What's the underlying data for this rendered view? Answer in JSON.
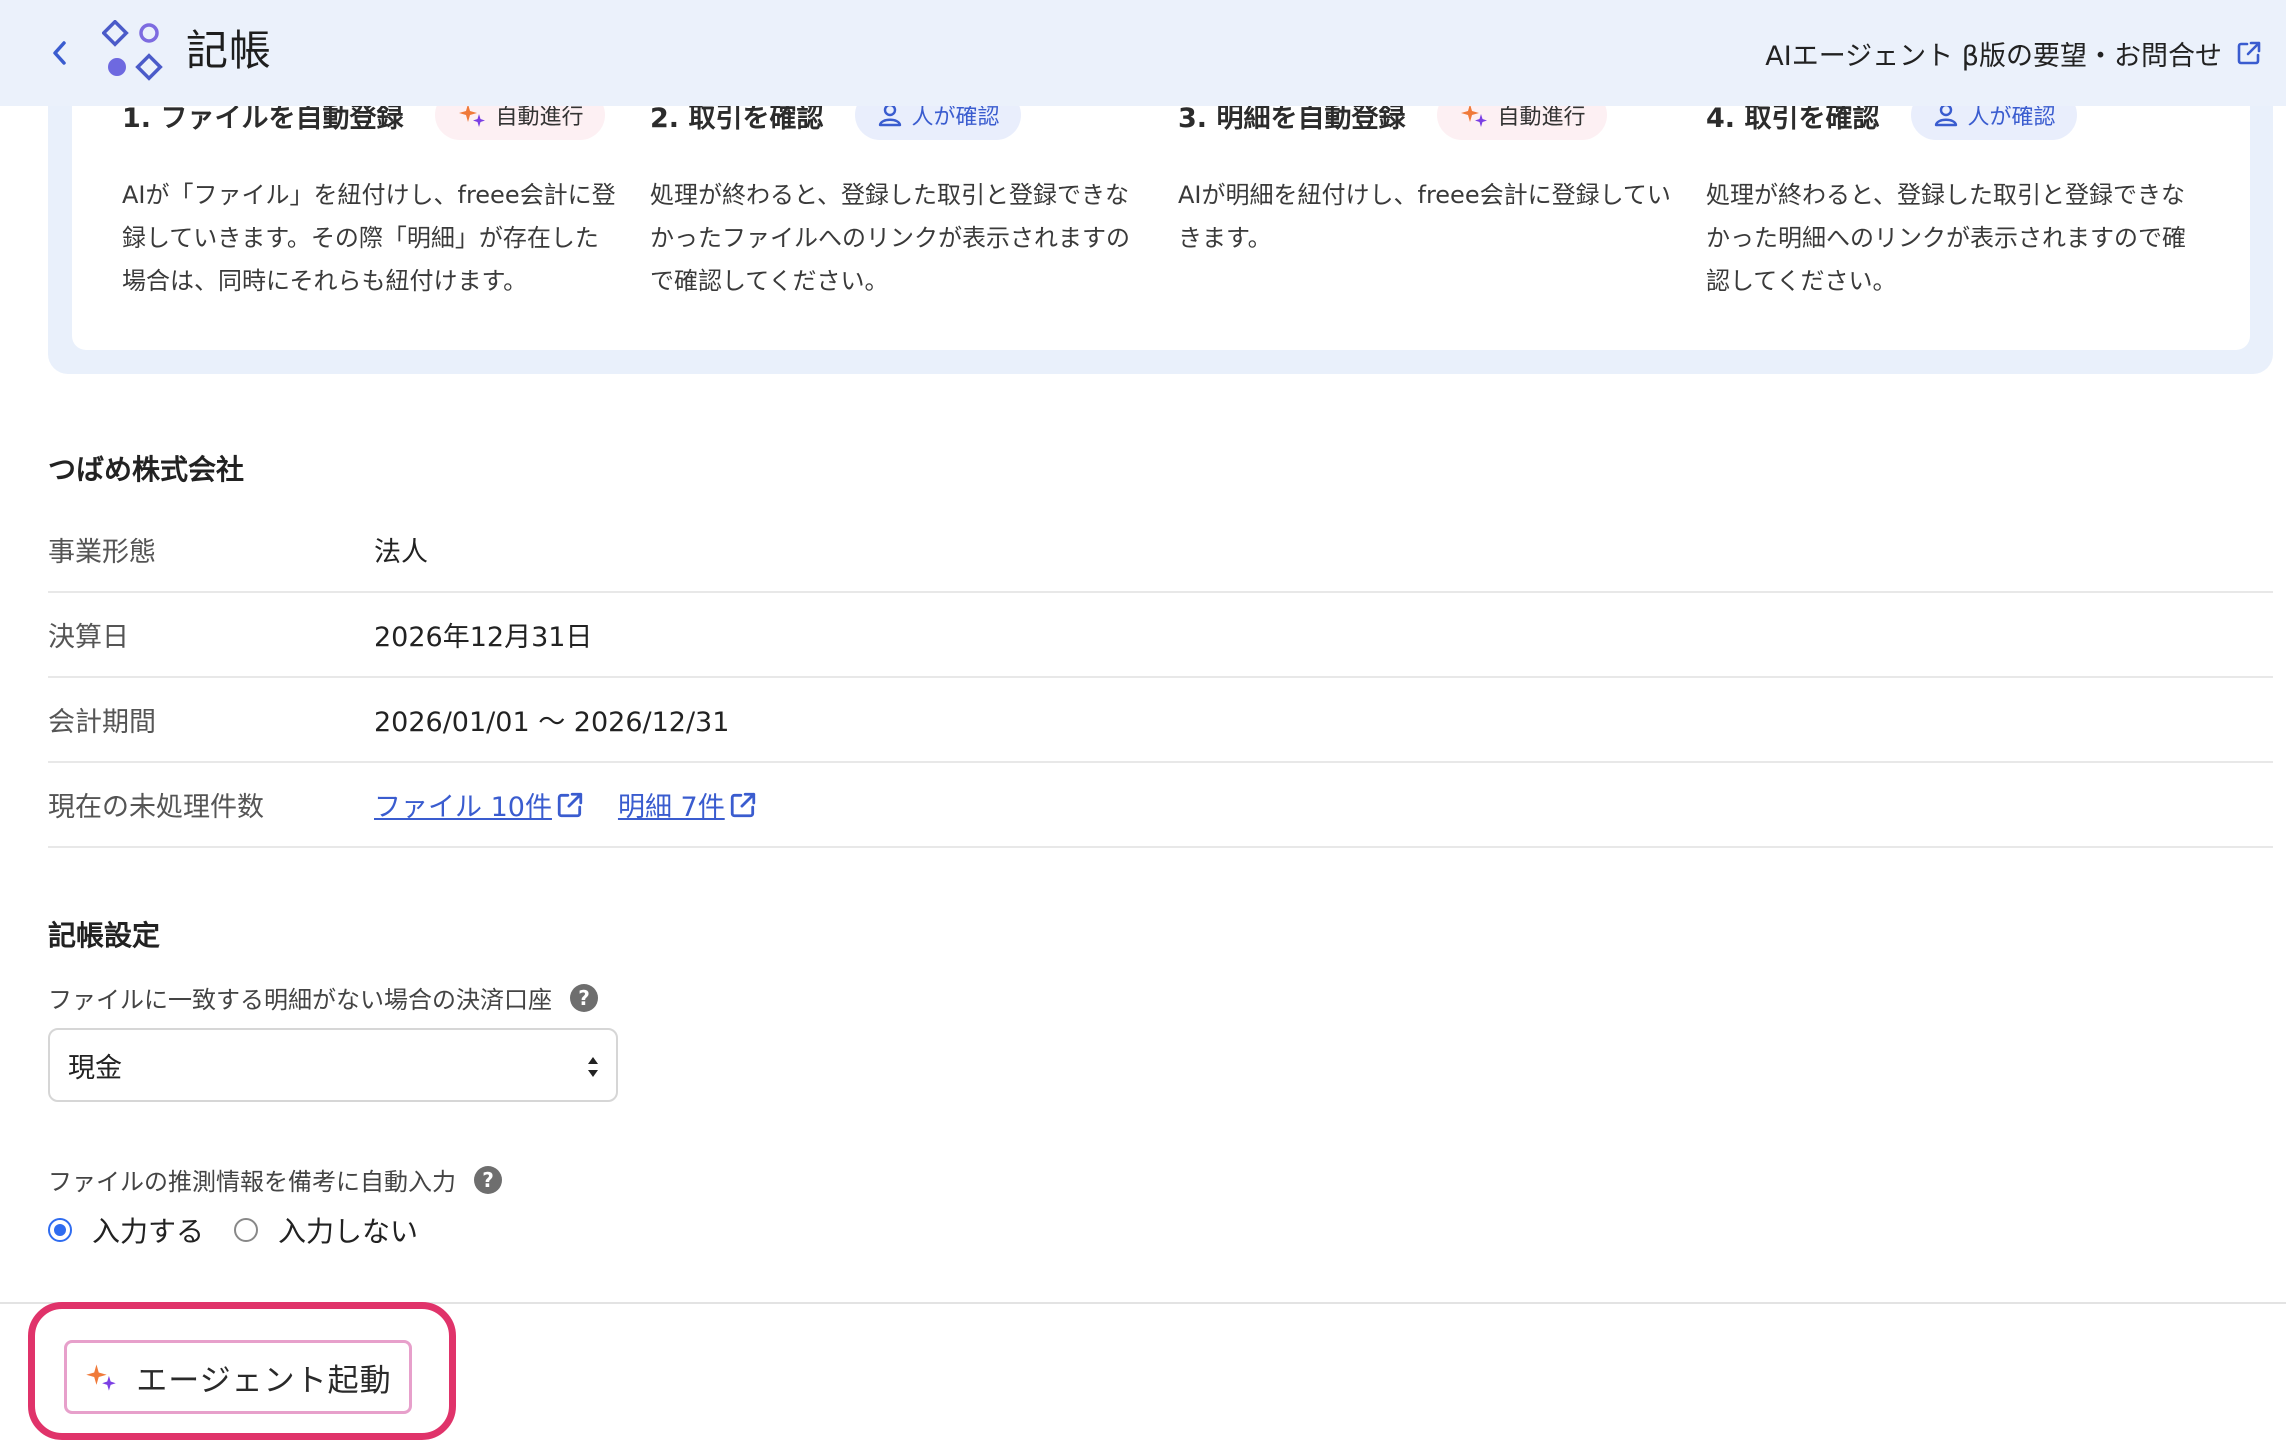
{
  "header": {
    "title": "記帳",
    "feedback_link": "AIエージェント β版の要望・お問合せ"
  },
  "steps": [
    {
      "title": "1. ファイルを自動登録",
      "badge": "自動進行",
      "badge_type": "auto",
      "desc": "AIが「ファイル」を紐付けし、freee会計に登録していきます。その際「明細」が存在した場合は、同時にそれらも紐付けます。"
    },
    {
      "title": "2. 取引を確認",
      "badge": "人が確認",
      "badge_type": "human",
      "desc": "処理が終わると、登録した取引と登録できなかったファイルへのリンクが表示されますので確認してください。"
    },
    {
      "title": "3. 明細を自動登録",
      "badge": "自動進行",
      "badge_type": "auto",
      "desc": "AIが明細を紐付けし、freee会計に登録していきます。"
    },
    {
      "title": "4. 取引を確認",
      "badge": "人が確認",
      "badge_type": "human",
      "desc": "処理が終わると、登録した取引と登録できなかった明細へのリンクが表示されますので確認してください。"
    }
  ],
  "company": {
    "name": "つばめ株式会社",
    "rows": {
      "business_type": {
        "label": "事業形態",
        "value": "法人"
      },
      "closing_date": {
        "label": "決算日",
        "value": "2026年12月31日"
      },
      "fiscal_period": {
        "label": "会計期間",
        "value": "2026/01/01 〜 2026/12/31"
      },
      "pending": {
        "label": "現在の未処理件数",
        "files_link": "ファイル 10件",
        "statements_link": "明細 7件"
      }
    }
  },
  "settings": {
    "title": "記帳設定",
    "account_label": "ファイルに一致する明細がない場合の決済口座",
    "account_value": "現金",
    "memo_label": "ファイルの推測情報を備考に自動入力",
    "memo_options": [
      "入力する",
      "入力しない"
    ],
    "memo_selected": "入力する"
  },
  "footer": {
    "agent_button": "エージェント起動"
  },
  "colors": {
    "header_bg": "#ebf1fb",
    "link": "#3a5ccf",
    "highlight": "#e0336a",
    "radio_selected": "#2f6cf0",
    "sparkle_purple": "#7b3fe4",
    "sparkle_orange": "#f07a3a"
  },
  "icons": {
    "back": "chevron-left-icon",
    "logo": "app-grid-icon",
    "external": "external-link-icon",
    "auto": "sparkle-icon",
    "human": "person-icon",
    "help": "question-icon"
  }
}
